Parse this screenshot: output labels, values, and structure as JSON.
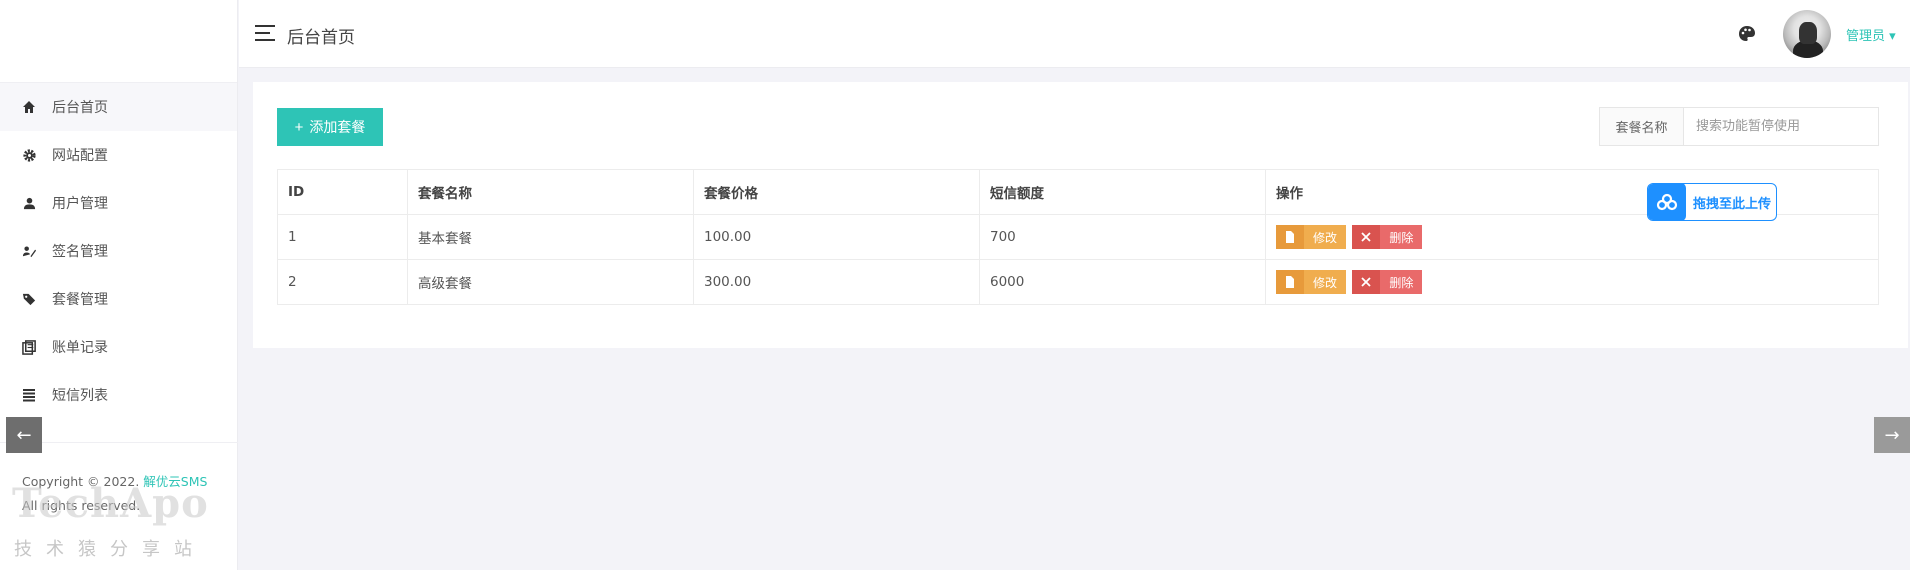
{
  "header": {
    "title": "后台首页",
    "user_label": "管理员"
  },
  "sidebar": {
    "items": [
      {
        "label": "后台首页",
        "icon": "home-icon"
      },
      {
        "label": "网站配置",
        "icon": "gear-icon"
      },
      {
        "label": "用户管理",
        "icon": "user-icon"
      },
      {
        "label": "签名管理",
        "icon": "signature-icon"
      },
      {
        "label": "套餐管理",
        "icon": "tags-icon"
      },
      {
        "label": "账单记录",
        "icon": "book-icon"
      },
      {
        "label": "短信列表",
        "icon": "list-icon"
      }
    ],
    "copyright_prefix": "Copyright © 2022.",
    "brand": "解优云SMS",
    "rights": "All rights reserved."
  },
  "watermark": {
    "title": "TechApo",
    "subtitle": "技术猿分享站"
  },
  "toolbar": {
    "add_label": "添加套餐",
    "search_label": "套餐名称",
    "search_placeholder": "搜索功能暂停使用"
  },
  "table": {
    "headers": [
      "ID",
      "套餐名称",
      "套餐价格",
      "短信额度",
      "操作"
    ],
    "rows": [
      {
        "id": "1",
        "name": "基本套餐",
        "price": "100.00",
        "quota": "700"
      },
      {
        "id": "2",
        "name": "高级套餐",
        "price": "300.00",
        "quota": "6000"
      }
    ],
    "edit_label": "修改",
    "delete_label": "删除"
  },
  "upload": {
    "label": "拖拽至此上传"
  },
  "colors": {
    "accent": "#2ec4b6",
    "edit": "#f0ad4e",
    "delete": "#e96a6a",
    "upload": "#1e90ff"
  }
}
